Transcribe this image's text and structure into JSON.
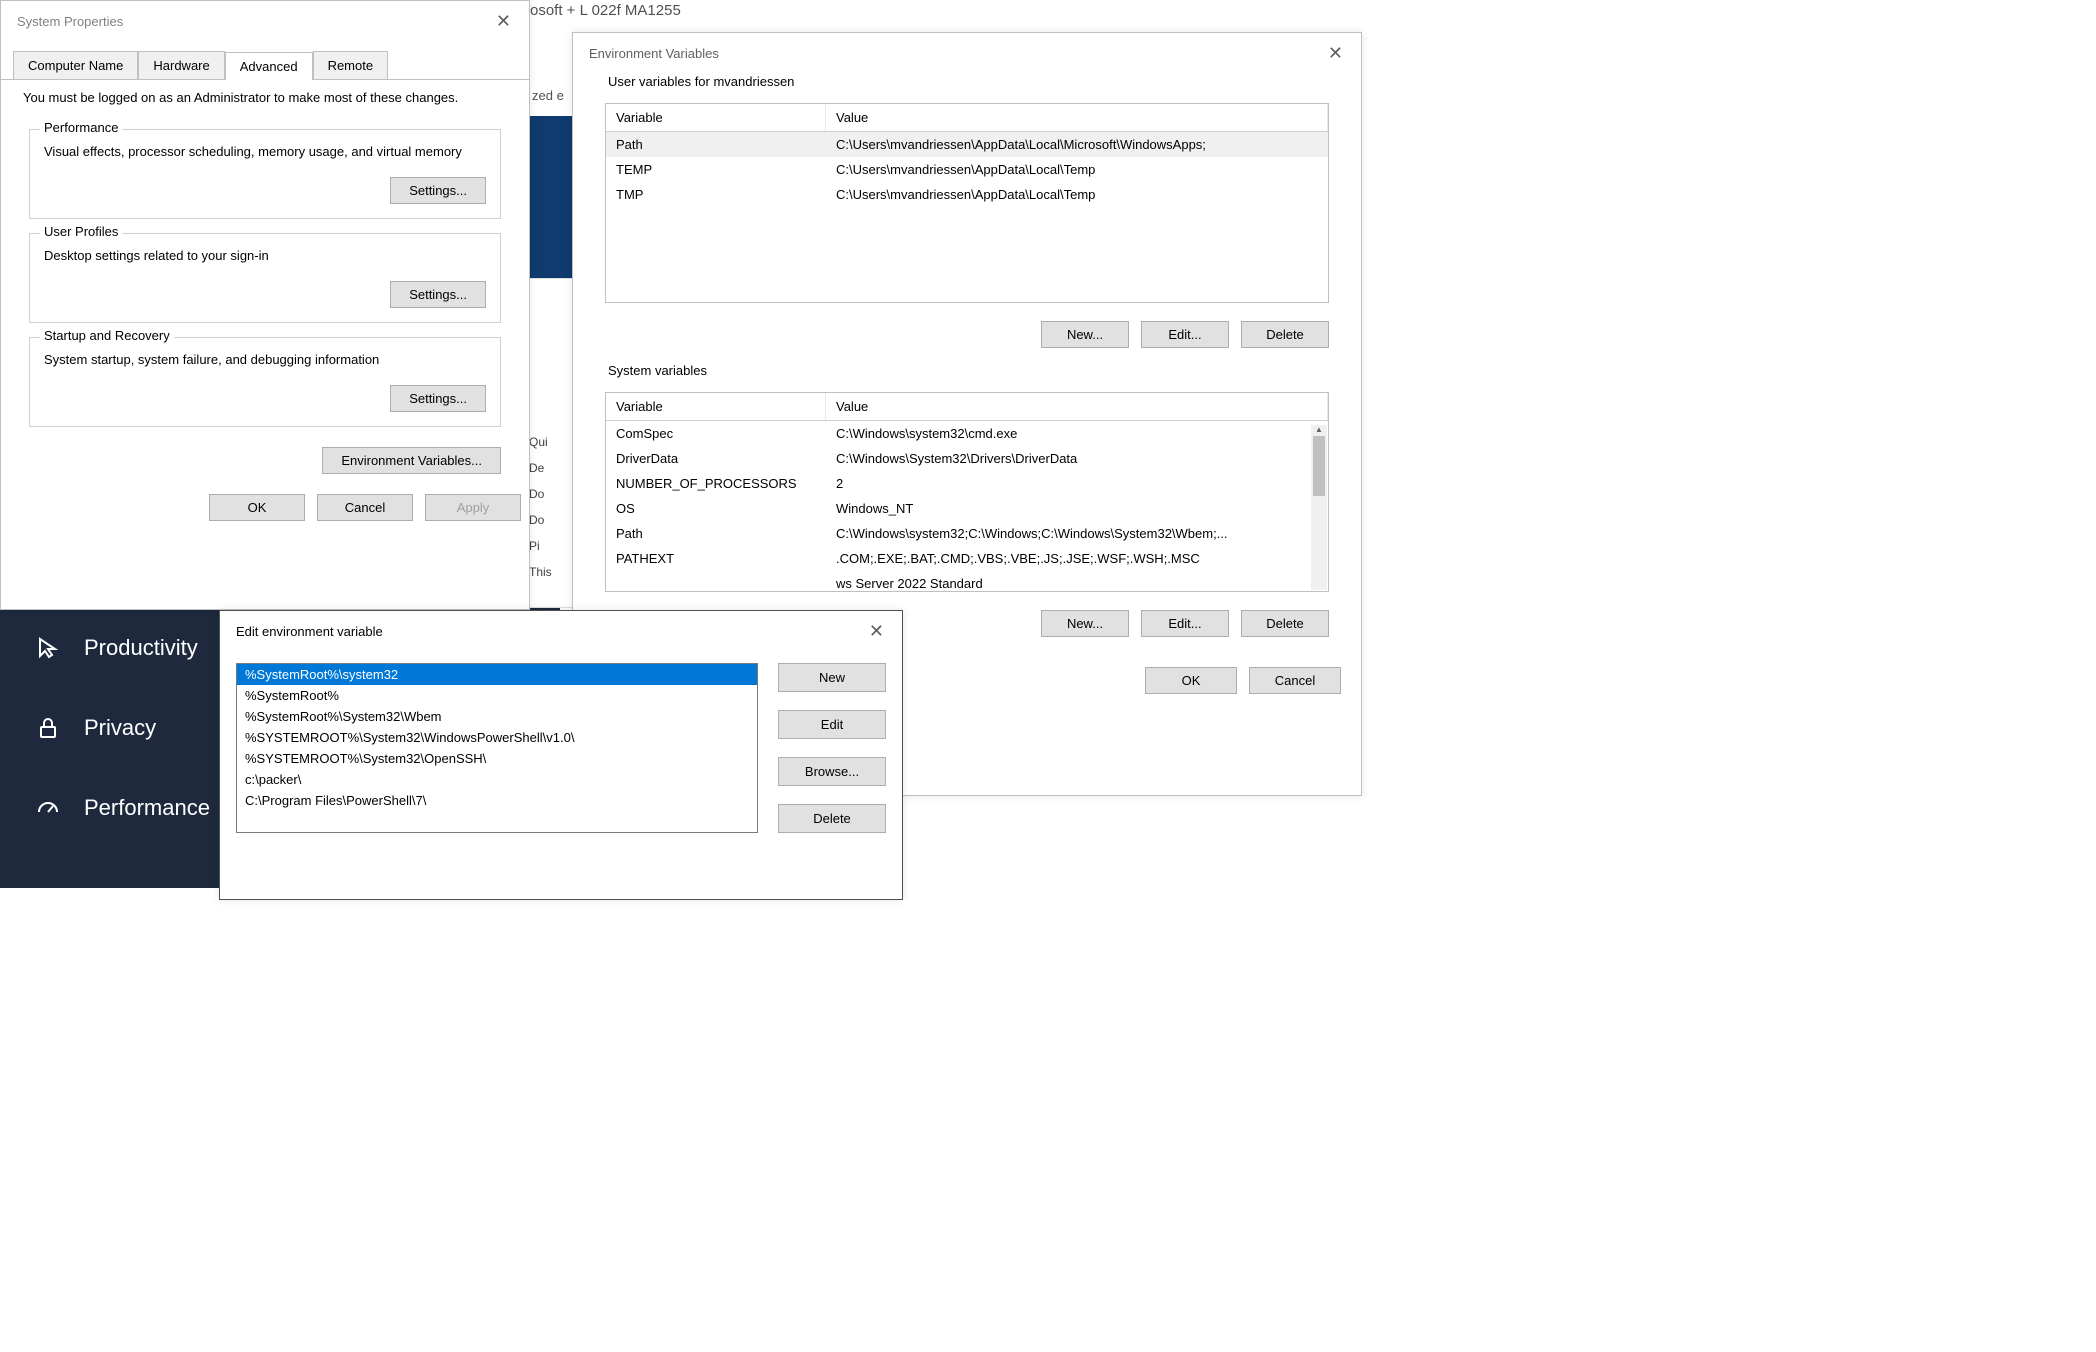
{
  "sysprops": {
    "title": "System Properties",
    "intro": "You must be logged on as an Administrator to make most of these changes.",
    "tabs": {
      "computer_name": "Computer Name",
      "hardware": "Hardware",
      "advanced": "Advanced",
      "remote": "Remote"
    },
    "performance": {
      "legend": "Performance",
      "desc": "Visual effects, processor scheduling, memory usage, and virtual memory",
      "settings_btn": "Settings..."
    },
    "user_profiles": {
      "legend": "User Profiles",
      "desc": "Desktop settings related to your sign-in",
      "settings_btn": "Settings..."
    },
    "startup": {
      "legend": "Startup and Recovery",
      "desc": "System startup, system failure, and debugging information",
      "settings_btn": "Settings..."
    },
    "env_btn": "Environment Variables...",
    "ok": "OK",
    "cancel": "Cancel",
    "apply": "Apply"
  },
  "envvars": {
    "title": "Environment Variables",
    "user_section": "User variables for mvandriessen",
    "system_section": "System variables",
    "headers": {
      "variable": "Variable",
      "value": "Value"
    },
    "user_rows": [
      {
        "var": "Path",
        "val": "C:\\Users\\mvandriessen\\AppData\\Local\\Microsoft\\WindowsApps;"
      },
      {
        "var": "TEMP",
        "val": "C:\\Users\\mvandriessen\\AppData\\Local\\Temp"
      },
      {
        "var": "TMP",
        "val": "C:\\Users\\mvandriessen\\AppData\\Local\\Temp"
      }
    ],
    "user_selected_index": 0,
    "sys_rows": [
      {
        "var": "ComSpec",
        "val": "C:\\Windows\\system32\\cmd.exe"
      },
      {
        "var": "DriverData",
        "val": "C:\\Windows\\System32\\Drivers\\DriverData"
      },
      {
        "var": "NUMBER_OF_PROCESSORS",
        "val": "2"
      },
      {
        "var": "OS",
        "val": "Windows_NT"
      },
      {
        "var": "Path",
        "val": "C:\\Windows\\system32;C:\\Windows;C:\\Windows\\System32\\Wbem;..."
      },
      {
        "var": "PATHEXT",
        "val": ".COM;.EXE;.BAT;.CMD;.VBS;.VBE;.JS;.JSE;.WSF;.WSH;.MSC"
      },
      {
        "var": "",
        "val": "ws Server 2022 Standard"
      }
    ],
    "new_btn": "New...",
    "edit_btn": "Edit...",
    "delete_btn": "Delete",
    "ok": "OK",
    "cancel": "Cancel"
  },
  "editvar": {
    "title": "Edit environment variable",
    "items": [
      "%SystemRoot%\\system32",
      "%SystemRoot%",
      "%SystemRoot%\\System32\\Wbem",
      "%SYSTEMROOT%\\System32\\WindowsPowerShell\\v1.0\\",
      "%SYSTEMROOT%\\System32\\OpenSSH\\",
      "c:\\packer\\",
      "C:\\Program Files\\PowerShell\\7\\"
    ],
    "selected_index": 0,
    "new_btn": "New",
    "edit_btn": "Edit",
    "browse_btn": "Browse...",
    "delete_btn": "Delete"
  },
  "sidebar": {
    "productivity": "Productivity",
    "privacy": "Privacy",
    "performance": "Performance"
  },
  "bg": {
    "top_fragment": "osoft                            +   L 022f                 MA1255",
    "zed": "zed e",
    "qui": "Qui",
    "de": "De",
    "do1": "Do",
    "do2": "Do",
    "pi": "Pi",
    "this": "This"
  }
}
